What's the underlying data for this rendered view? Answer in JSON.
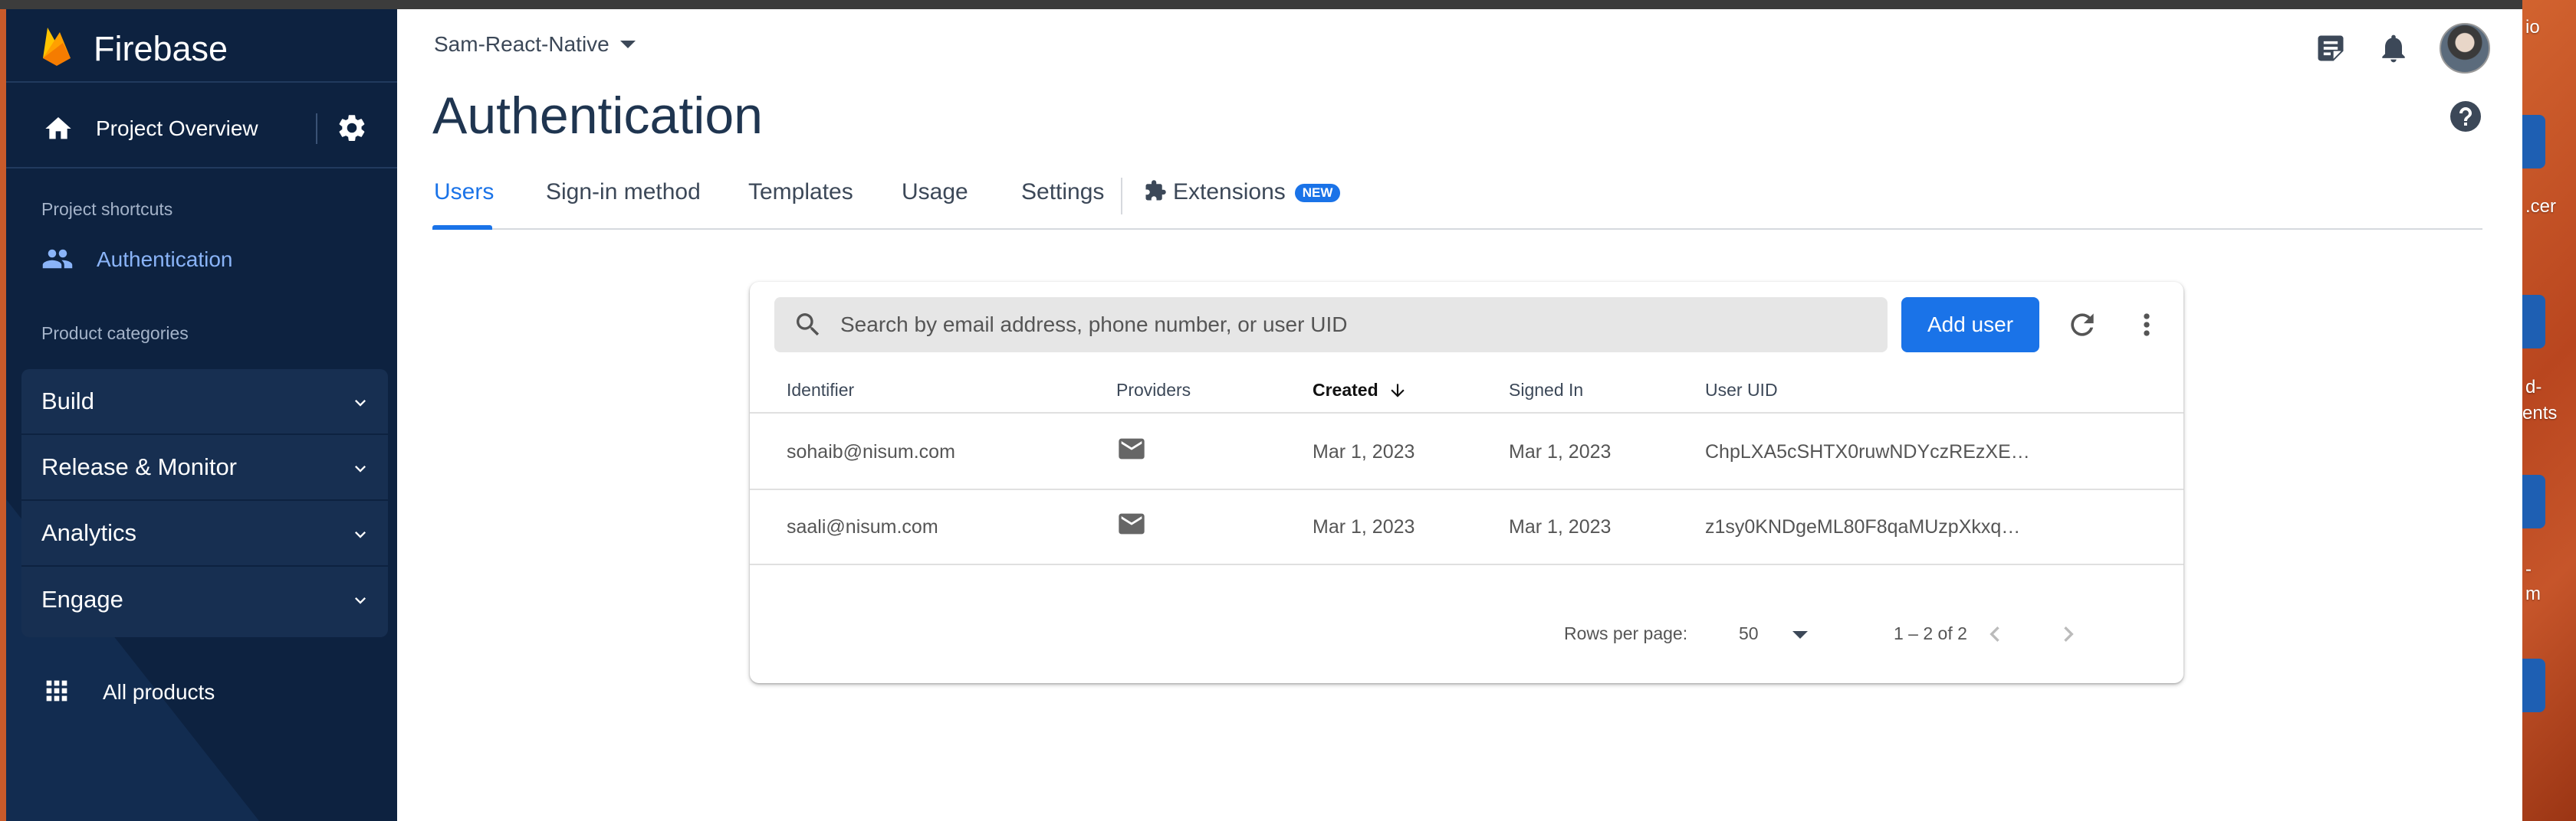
{
  "sidebar": {
    "brand": "Firebase",
    "project_overview": "Project Overview",
    "shortcuts_label": "Project shortcuts",
    "shortcut_auth": "Authentication",
    "categories_label": "Product categories",
    "categories": [
      "Build",
      "Release & Monitor",
      "Analytics",
      "Engage"
    ],
    "all_products": "All products"
  },
  "header": {
    "project": "Sam-React-Native",
    "title": "Authentication"
  },
  "tabs": {
    "users": "Users",
    "signin": "Sign-in method",
    "templates": "Templates",
    "usage": "Usage",
    "settings": "Settings",
    "extensions": "Extensions",
    "new_badge": "NEW"
  },
  "users_table": {
    "search_placeholder": "Search by email address, phone number, or user UID",
    "add_user": "Add user",
    "columns": [
      "Identifier",
      "Providers",
      "Created",
      "Signed In",
      "User UID"
    ],
    "rows": [
      {
        "identifier": "sohaib@nisum.com",
        "provider": "email",
        "created": "Mar 1, 2023",
        "signed_in": "Mar 1, 2023",
        "uid": "ChpLXA5cSHTX0ruwNDYczREzXE…"
      },
      {
        "identifier": "saali@nisum.com",
        "provider": "email",
        "created": "Mar 1, 2023",
        "signed_in": "Mar 1, 2023",
        "uid": "z1sy0KNDgeML80F8qaMUzpXkxq…"
      }
    ],
    "rows_per_page_label": "Rows per page:",
    "rows_per_page": "50",
    "range": "1 – 2 of 2"
  },
  "desktop": {
    "labels": [
      "io",
      ".cer",
      "d-",
      "ents",
      "-",
      "m"
    ]
  },
  "colors": {
    "sidebar_bg": "#0d2240",
    "accent": "#1a73e8",
    "firebase_orange": "#ffa000"
  }
}
